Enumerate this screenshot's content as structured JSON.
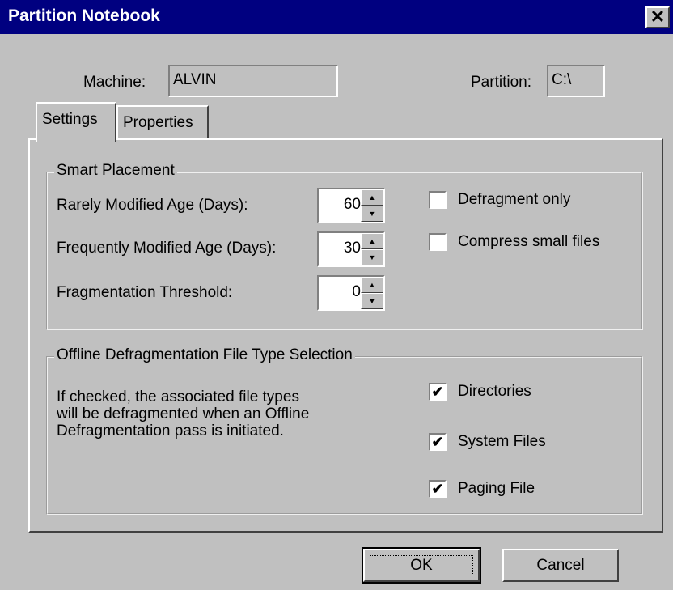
{
  "window": {
    "title": "Partition Notebook",
    "close_glyph": "✕"
  },
  "header": {
    "machine_label": "Machine:",
    "machine_value": "ALVIN",
    "partition_label": "Partition:",
    "partition_value": "C:\\"
  },
  "tabs": [
    {
      "label": "Settings",
      "active": true
    },
    {
      "label": "Properties",
      "active": false
    }
  ],
  "smart_placement": {
    "title": "Smart Placement",
    "rarely_label": "Rarely Modified Age (Days):",
    "rarely_value": "60",
    "frequently_label": "Frequently Modified Age (Days):",
    "frequently_value": "30",
    "threshold_label": "Fragmentation Threshold:",
    "threshold_value": "0",
    "defragment_only": {
      "label": "Defragment only",
      "checked": false
    },
    "compress_small": {
      "label": "Compress small files",
      "checked": false
    }
  },
  "offline": {
    "title": "Offline Defragmentation File Type Selection",
    "description_lines": [
      "If checked, the associated file types",
      "will be defragmented when an Offline",
      "Defragmentation pass is initiated."
    ],
    "directories": {
      "label": "Directories",
      "checked": true
    },
    "system_files": {
      "label": "System Files",
      "checked": true
    },
    "paging_file": {
      "label": "Paging File",
      "checked": true
    }
  },
  "buttons": {
    "ok_underlined": "O",
    "ok_rest": "K",
    "cancel_underlined": "C",
    "cancel_rest": "ancel"
  },
  "icons": {
    "spin_up": "▲",
    "spin_down": "▼",
    "check": "✔"
  },
  "colors": {
    "titlebar": "#000080",
    "face": "#c0c0c0"
  }
}
